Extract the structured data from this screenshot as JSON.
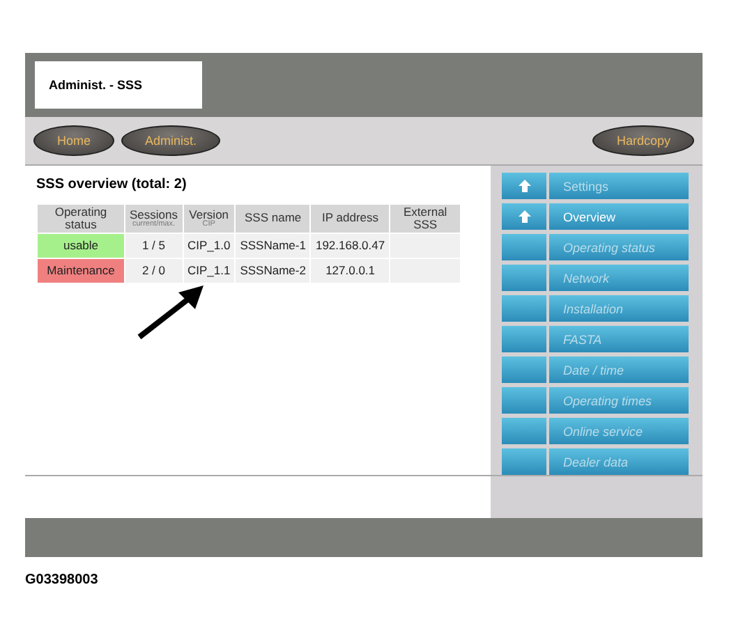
{
  "window": {
    "title": "Administ. - SSS"
  },
  "nav_buttons": [
    "Home",
    "Administ."
  ],
  "hardcopy_button": "Hardcopy",
  "overview": {
    "title": "SSS overview (total: 2)",
    "columns": [
      {
        "label": "Operating status"
      },
      {
        "label": "Sessions",
        "sub": "current/max."
      },
      {
        "label": "Version",
        "sub": "CIP"
      },
      {
        "label": "SSS name"
      },
      {
        "label": "IP address"
      },
      {
        "label": "External SSS"
      }
    ],
    "rows": [
      {
        "status": "usable",
        "color": "#a6f08c",
        "sessions": "1 / 5",
        "version": "CIP_1.0",
        "name": "SSSName-1",
        "ip": "192.168.0.47"
      },
      {
        "status": "Maintenance",
        "color": "#f08080",
        "sessions": "2 / 0",
        "version": "CIP_1.1",
        "name": "SSSName-2",
        "ip": "127.0.0.1"
      }
    ]
  },
  "menu": [
    {
      "label": "Settings",
      "kind": "up",
      "selected": false
    },
    {
      "label": "Overview",
      "kind": "up",
      "selected": true
    },
    {
      "label": "Operating status",
      "kind": "page",
      "selected": false
    },
    {
      "label": "Network",
      "kind": "page",
      "selected": false
    },
    {
      "label": "Installation",
      "kind": "page",
      "selected": false
    },
    {
      "label": "FASTA",
      "kind": "page",
      "selected": false
    },
    {
      "label": "Date / time",
      "kind": "page",
      "selected": false
    },
    {
      "label": "Operating times",
      "kind": "page",
      "selected": false
    },
    {
      "label": "Online service",
      "kind": "page",
      "selected": false
    },
    {
      "label": "Dealer data",
      "kind": "page",
      "selected": false
    }
  ],
  "caption": "G03398003"
}
